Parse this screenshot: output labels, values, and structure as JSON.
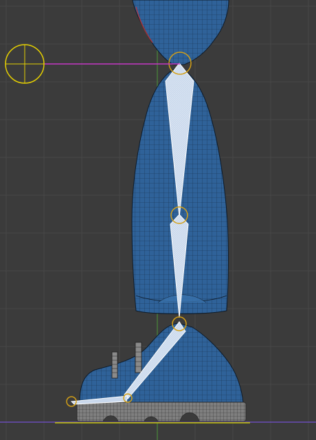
{
  "viewport": {
    "view": "3d-viewport-side",
    "colors": {
      "background": "#3b3b3b",
      "grid_line": "#474747",
      "mesh_fill": "#2f6299",
      "mesh_fill_dark": "#1f4670",
      "wire": "#0d1a28",
      "bone_fill": "#c9d8ec",
      "bone_outline": "#ffffff",
      "foot_base": "#7f7f7f",
      "ik_target_circle": "#e6d000",
      "ik_line": "#c638c6",
      "joint_circle": "#d4a017",
      "x_axis": "#6b4db8",
      "y_axis": "#4d9a3a",
      "ground_line": "#c8c800"
    },
    "icons": [
      "ik-target-icon",
      "joint-circle-icon",
      "bone-icon",
      "screw-icon"
    ]
  }
}
